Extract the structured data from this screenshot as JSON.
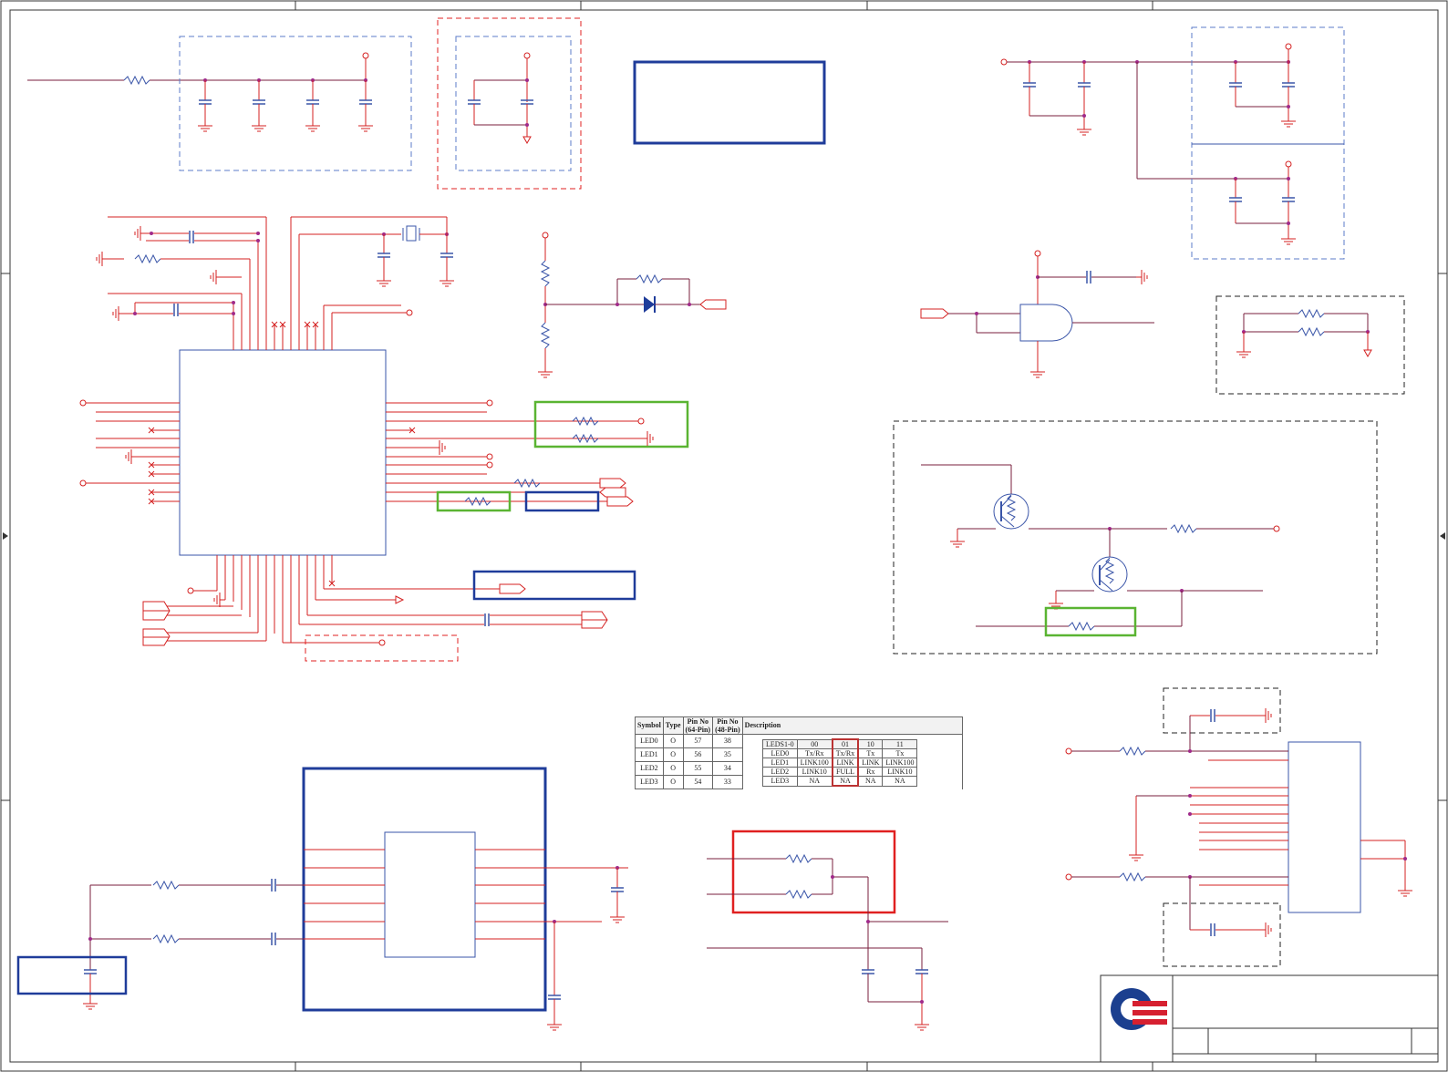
{
  "led_pin_table": {
    "headers": [
      "Symbol",
      "Type",
      "Pin No\n(64-Pin)",
      "Pin No\n(48-Pin)",
      "Description"
    ],
    "rows": [
      {
        "symbol": "LED0",
        "type": "O",
        "pin64": "57",
        "pin48": "38"
      },
      {
        "symbol": "LED1",
        "type": "O",
        "pin64": "56",
        "pin48": "35"
      },
      {
        "symbol": "LED2",
        "type": "O",
        "pin64": "55",
        "pin48": "34"
      },
      {
        "symbol": "LED3",
        "type": "O",
        "pin64": "54",
        "pin48": "33"
      }
    ]
  },
  "led_mode_table": {
    "header": [
      "LEDS1-0",
      "00",
      "01",
      "10",
      "11"
    ],
    "rows": [
      [
        "LED0",
        "Tx/Rx",
        "Tx/Rx",
        "Tx",
        "Tx"
      ],
      [
        "LED1",
        "LINK100",
        "LINK",
        "LINK",
        "LINK100"
      ],
      [
        "LED2",
        "LINK10",
        "FULL",
        "Rx",
        "LINK10"
      ],
      [
        "LED3",
        "NA",
        "NA",
        "NA",
        "NA"
      ]
    ],
    "highlighted_column": "01"
  },
  "colors": {
    "wire": "#d42020",
    "net": "#7a1f3d",
    "symbol": "#3a55a8",
    "block_blue": "#1f3c9a",
    "highlight_green": "#5ab432",
    "highlight_red": "#e02020",
    "dashed_blue": "#5b7bc8",
    "dashed_black": "#222222",
    "logo_blue": "#1b3f8f",
    "logo_red": "#d62030"
  }
}
